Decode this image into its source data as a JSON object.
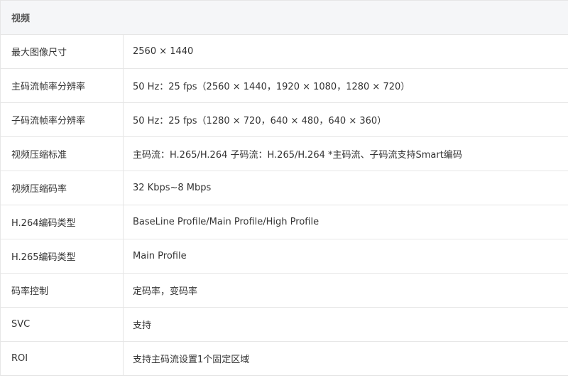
{
  "section": {
    "title": "视频"
  },
  "rows": [
    {
      "label": "最大图像尺寸",
      "value": "2560 × 1440"
    },
    {
      "label": "主码流帧率分辨率",
      "value": "50 Hz：25 fps（2560 × 1440，1920 × 1080，1280 × 720）"
    },
    {
      "label": "子码流帧率分辨率",
      "value": "50 Hz：25 fps（1280 × 720，640 × 480，640 × 360）"
    },
    {
      "label": "视频压缩标准",
      "value": "主码流：H.265/H.264 子码流：H.265/H.264 *主码流、子码流支持Smart编码"
    },
    {
      "label": "视频压缩码率",
      "value": "32 Kbps~8 Mbps"
    },
    {
      "label": "H.264编码类型",
      "value": "BaseLine Profile/Main Profile/High Profile"
    },
    {
      "label": "H.265编码类型",
      "value": "Main Profile"
    },
    {
      "label": "码率控制",
      "value": "定码率，变码率"
    },
    {
      "label": "SVC",
      "value": "支持"
    },
    {
      "label": "ROI",
      "value": "支持主码流设置1个固定区域"
    }
  ]
}
